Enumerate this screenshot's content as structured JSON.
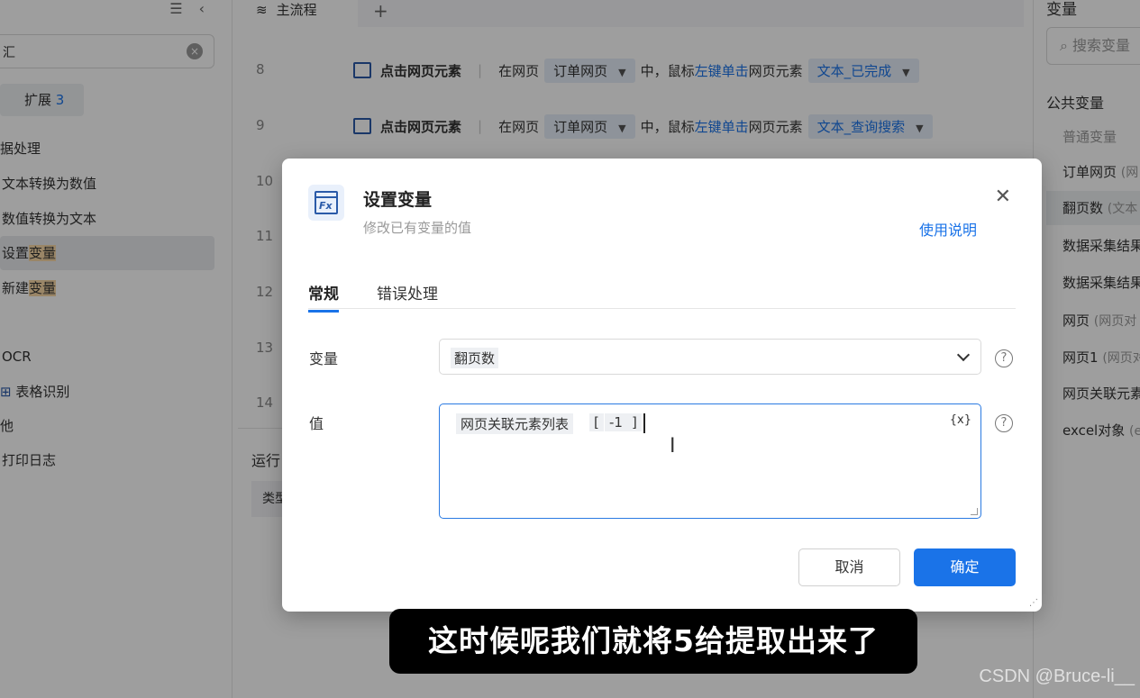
{
  "left_panel": {
    "search_value": "汇",
    "expand": {
      "label": "扩展",
      "count": "3"
    },
    "items": [
      {
        "text": "据处理"
      },
      {
        "text": "文本转换为数值"
      },
      {
        "text": "数值转换为文本"
      },
      {
        "prefix": "设置",
        "highlight": "变量"
      },
      {
        "prefix": "新建",
        "highlight": "变量"
      },
      {
        "text": "OCR"
      },
      {
        "text": "表格识别"
      },
      {
        "text": "他"
      },
      {
        "text": "打印日志"
      }
    ]
  },
  "main_flow": {
    "tab": "主流程",
    "add_tab": "+",
    "row_numbers": [
      "8",
      "9",
      "10",
      "11",
      "12",
      "13",
      "14"
    ],
    "steps": [
      {
        "name": "点击网页元素",
        "pre": "在网页",
        "page": "订单网页",
        "mid": "中，鼠标",
        "action": "左键单击",
        "post": "网页元素",
        "element": "文本_已完成"
      },
      {
        "name": "点击网页元素",
        "pre": "在网页",
        "page": "订单网页",
        "mid": "中，鼠标",
        "action": "左键单击",
        "post": "网页元素",
        "element": "文本_查询搜索"
      }
    ],
    "run_label": "运行",
    "table_head": "类型"
  },
  "right_panel": {
    "title": "变量",
    "search_placeholder": "搜索变量",
    "section": "公共变量",
    "items": [
      {
        "label": "普通变量",
        "sub": ""
      },
      {
        "label": "订单网页",
        "sub": "(网"
      },
      {
        "label": "翻页数",
        "sub": "(文本"
      },
      {
        "label": "数据采集结果",
        "sub": ""
      },
      {
        "label": "数据采集结果",
        "sub": ""
      },
      {
        "label": "网页",
        "sub": "(网页对"
      },
      {
        "label": "网页1",
        "sub": "(网页对"
      },
      {
        "label": "网页关联元素",
        "sub": ""
      },
      {
        "label": "excel对象",
        "sub": "(e"
      }
    ]
  },
  "modal": {
    "title": "设置变量",
    "subtitle": "修改已有变量的值",
    "help": "使用说明",
    "close": "✕",
    "tabs": [
      "常规",
      "错误处理"
    ],
    "variable_label": "变量",
    "variable_value": "翻页数",
    "value_label": "值",
    "value_tokens": [
      "网页关联元素列表",
      "[",
      "-1",
      "]"
    ],
    "insert_var": "{x}",
    "cancel": "取消",
    "ok": "确定"
  },
  "caption": "这时候呢我们就将5给提取出来了",
  "watermark": "CSDN @Bruce-li__"
}
